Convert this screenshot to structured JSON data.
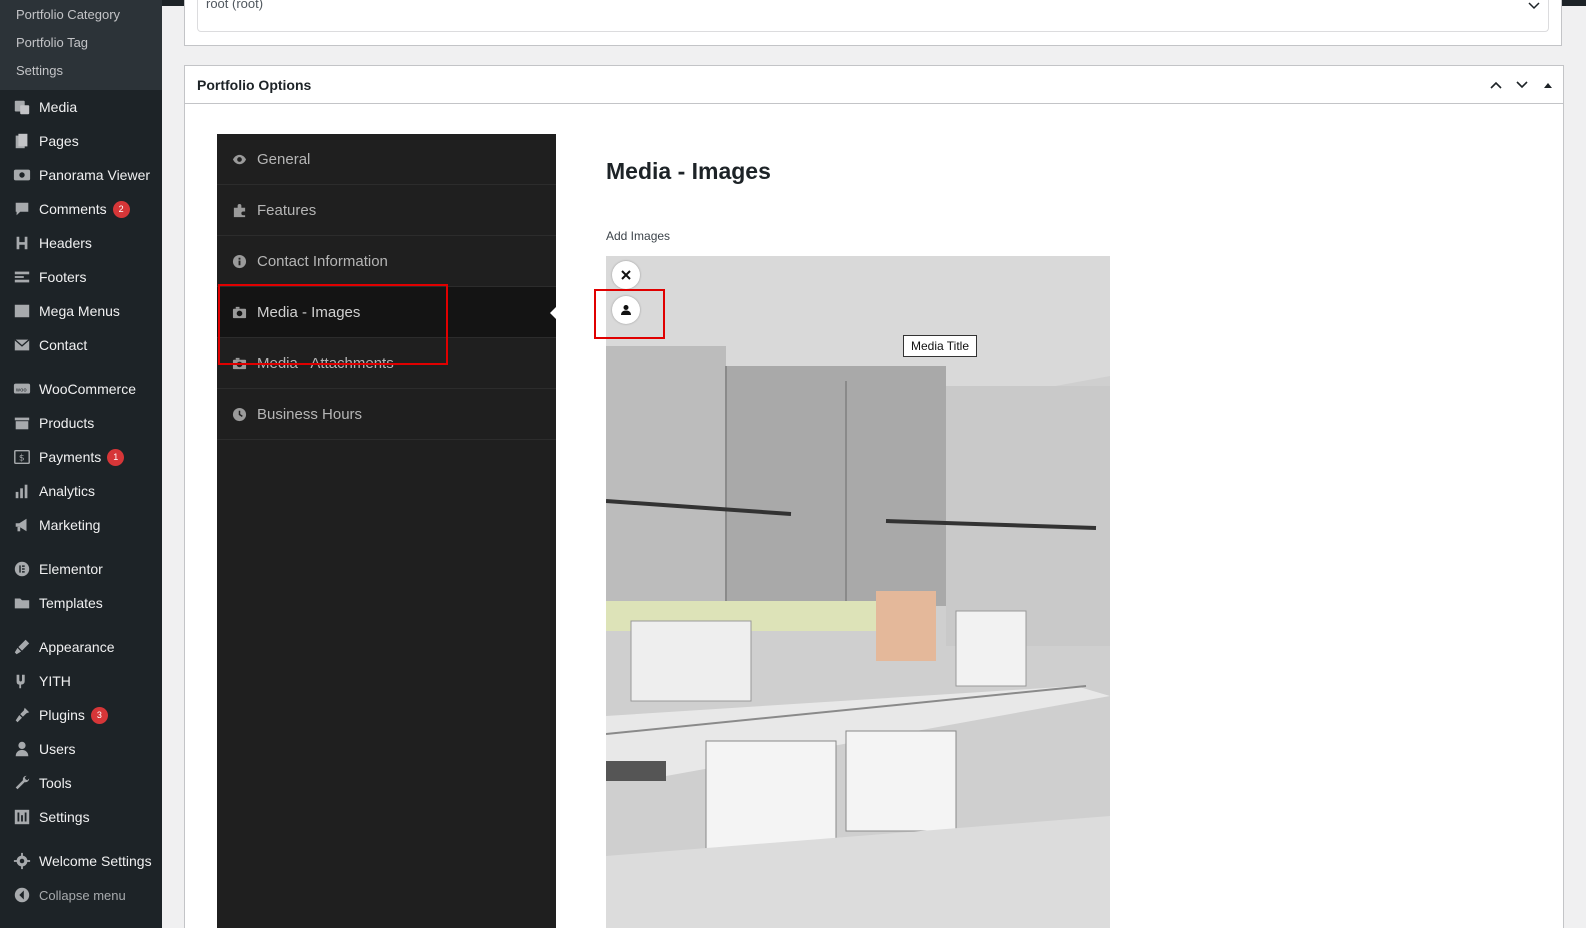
{
  "sidebar": {
    "submenu": [
      "Portfolio Category",
      "Portfolio Tag",
      "Settings"
    ],
    "items": [
      {
        "label": "Media",
        "icon": "media-icon"
      },
      {
        "label": "Pages",
        "icon": "pages-icon"
      },
      {
        "label": "Panorama Viewer",
        "icon": "panorama-icon"
      },
      {
        "label": "Comments",
        "icon": "comments-icon",
        "badge": "2"
      },
      {
        "label": "Headers",
        "icon": "headers-icon"
      },
      {
        "label": "Footers",
        "icon": "footers-icon"
      },
      {
        "label": "Mega Menus",
        "icon": "mega-menus-icon"
      },
      {
        "label": "Contact",
        "icon": "contact-icon"
      },
      {
        "label": "WooCommerce",
        "icon": "woocommerce-icon"
      },
      {
        "label": "Products",
        "icon": "products-icon"
      },
      {
        "label": "Payments",
        "icon": "payments-icon",
        "badge": "1"
      },
      {
        "label": "Analytics",
        "icon": "analytics-icon"
      },
      {
        "label": "Marketing",
        "icon": "marketing-icon"
      },
      {
        "label": "Elementor",
        "icon": "elementor-icon"
      },
      {
        "label": "Templates",
        "icon": "templates-icon"
      },
      {
        "label": "Appearance",
        "icon": "appearance-icon"
      },
      {
        "label": "YITH",
        "icon": "yith-icon"
      },
      {
        "label": "Plugins",
        "icon": "plugins-icon",
        "badge": "3"
      },
      {
        "label": "Users",
        "icon": "users-icon"
      },
      {
        "label": "Tools",
        "icon": "tools-icon"
      },
      {
        "label": "Settings",
        "icon": "settings-icon"
      },
      {
        "label": "Welcome Settings",
        "icon": "welcome-settings-icon"
      }
    ],
    "collapse_label": "Collapse menu"
  },
  "parent_select": {
    "value": "root (root)"
  },
  "options_box": {
    "title": "Portfolio Options",
    "tabs": [
      {
        "label": "General",
        "icon": "eye-icon"
      },
      {
        "label": "Features",
        "icon": "puzzle-icon"
      },
      {
        "label": "Contact Information",
        "icon": "info-icon"
      },
      {
        "label": "Media - Images",
        "icon": "camera-icon",
        "active": true
      },
      {
        "label": "Media - Attachments",
        "icon": "camera-icon"
      },
      {
        "label": "Business Hours",
        "icon": "clock-icon"
      }
    ],
    "section_title": "Media - Images",
    "add_images_label": "Add Images",
    "tooltip": "Media Title"
  },
  "colors": {
    "sidebar_bg": "#1d2327",
    "badge": "#d63638",
    "highlight": "#e00000",
    "tabs_bg": "#1f1f1f"
  }
}
